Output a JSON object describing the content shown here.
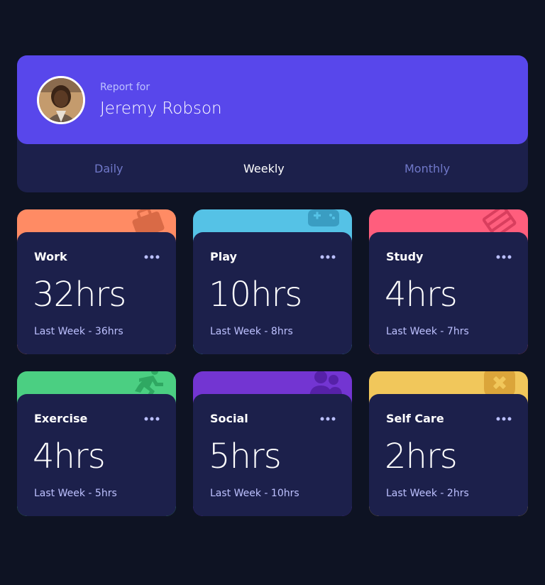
{
  "profile": {
    "report_for": "Report for",
    "name": "Jeremy Robson"
  },
  "tabs": [
    {
      "label": "Daily",
      "active": false
    },
    {
      "label": "Weekly",
      "active": true
    },
    {
      "label": "Monthly",
      "active": false
    }
  ],
  "activities": [
    {
      "title": "Work",
      "current": "32hrs",
      "previous": "Last Week - 36hrs",
      "color": "#ff8b64",
      "icon": "briefcase-icon"
    },
    {
      "title": "Play",
      "current": "10hrs",
      "previous": "Last Week - 8hrs",
      "color": "#55c2e6",
      "icon": "gamepad-icon"
    },
    {
      "title": "Study",
      "current": "4hrs",
      "previous": "Last Week - 7hrs",
      "color": "#ff5e7d",
      "icon": "book-icon"
    },
    {
      "title": "Exercise",
      "current": "4hrs",
      "previous": "Last Week - 5hrs",
      "color": "#4bcf82",
      "icon": "running-icon"
    },
    {
      "title": "Social",
      "current": "5hrs",
      "previous": "Last Week - 10hrs",
      "color": "#7335d2",
      "icon": "people-icon"
    },
    {
      "title": "Self Care",
      "current": "2hrs",
      "previous": "Last Week - 2hrs",
      "color": "#f1c75b",
      "icon": "bandage-icon"
    }
  ]
}
